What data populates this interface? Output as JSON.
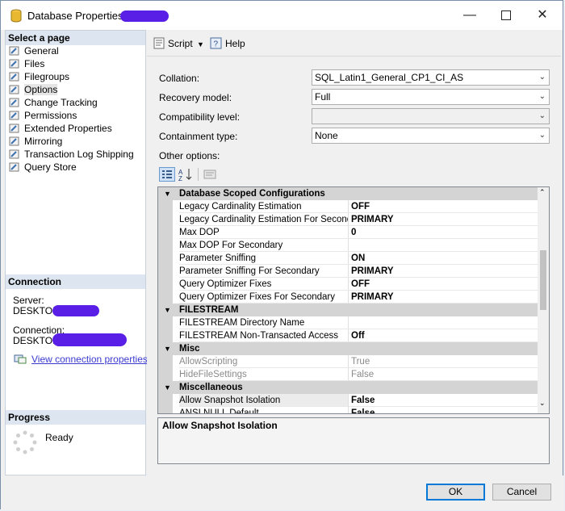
{
  "window": {
    "title": "Database Properties -",
    "controls": [
      "minimize",
      "maximize",
      "close"
    ]
  },
  "left": {
    "select_page_header": "Select a page",
    "pages": [
      {
        "label": "General",
        "selected": false
      },
      {
        "label": "Files",
        "selected": false
      },
      {
        "label": "Filegroups",
        "selected": false
      },
      {
        "label": "Options",
        "selected": true
      },
      {
        "label": "Change Tracking",
        "selected": false
      },
      {
        "label": "Permissions",
        "selected": false
      },
      {
        "label": "Extended Properties",
        "selected": false
      },
      {
        "label": "Mirroring",
        "selected": false
      },
      {
        "label": "Transaction Log Shipping",
        "selected": false
      },
      {
        "label": "Query Store",
        "selected": false
      }
    ],
    "connection_header": "Connection",
    "server_label": "Server:",
    "server_value": "DESKTOP-",
    "connection_label": "Connection:",
    "connection_value": "DESKTOP-",
    "view_connection_link": "View connection properties",
    "progress_header": "Progress",
    "progress_status": "Ready"
  },
  "toolbar": {
    "script_label": "Script",
    "help_label": "Help"
  },
  "form": {
    "collation_label": "Collation:",
    "collation_value": "SQL_Latin1_General_CP1_CI_AS",
    "recovery_label": "Recovery model:",
    "recovery_value": "Full",
    "compat_label": "Compatibility level:",
    "compat_value": "",
    "containment_label": "Containment type:",
    "containment_value": "None",
    "other_options_label": "Other options:"
  },
  "grid": {
    "rows": [
      {
        "type": "category",
        "name": "Database Scoped Configurations"
      },
      {
        "type": "prop",
        "name": "Legacy Cardinality Estimation",
        "value": "OFF"
      },
      {
        "type": "prop",
        "name": "Legacy Cardinality Estimation For Secondary",
        "value": "PRIMARY"
      },
      {
        "type": "prop",
        "name": "Max DOP",
        "value": "0"
      },
      {
        "type": "prop",
        "name": "Max DOP For Secondary",
        "value": ""
      },
      {
        "type": "prop",
        "name": "Parameter Sniffing",
        "value": "ON"
      },
      {
        "type": "prop",
        "name": "Parameter Sniffing For Secondary",
        "value": "PRIMARY"
      },
      {
        "type": "prop",
        "name": "Query Optimizer Fixes",
        "value": "OFF"
      },
      {
        "type": "prop",
        "name": "Query Optimizer Fixes For Secondary",
        "value": "PRIMARY"
      },
      {
        "type": "category",
        "name": "FILESTREAM"
      },
      {
        "type": "prop",
        "name": "FILESTREAM Directory Name",
        "value": ""
      },
      {
        "type": "prop",
        "name": "FILESTREAM Non-Transacted Access",
        "value": "Off"
      },
      {
        "type": "category",
        "name": "Misc"
      },
      {
        "type": "prop",
        "name": "AllowScripting",
        "value": "True",
        "dim": true
      },
      {
        "type": "prop",
        "name": "HideFileSettings",
        "value": "False",
        "dim": true
      },
      {
        "type": "category",
        "name": "Miscellaneous"
      },
      {
        "type": "prop",
        "name": "Allow Snapshot Isolation",
        "value": "False",
        "selected": true
      },
      {
        "type": "prop",
        "name": "ANSI NULL Default",
        "value": "False"
      }
    ]
  },
  "description": {
    "text": "Allow Snapshot Isolation"
  },
  "buttons": {
    "ok_label": "OK",
    "cancel_label": "Cancel"
  }
}
